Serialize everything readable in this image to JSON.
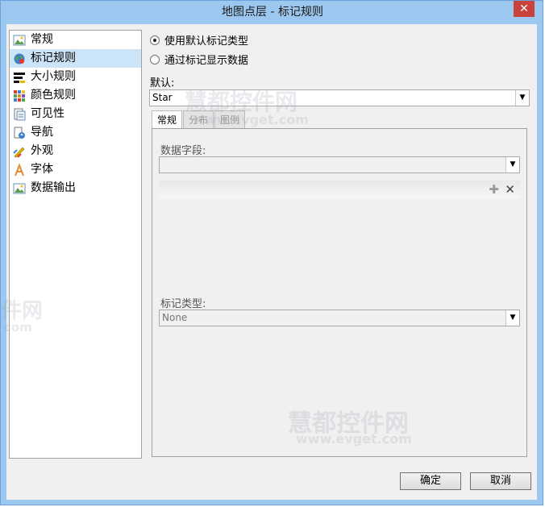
{
  "window": {
    "title": "地图点层 - 标记规则",
    "close_glyph": "✕"
  },
  "nav": {
    "items": [
      {
        "label": "常规",
        "icon": "landscape-icon",
        "active": false
      },
      {
        "label": "标记规则",
        "icon": "globe-marker-icon",
        "active": true
      },
      {
        "label": "大小规则",
        "icon": "size-bars-icon",
        "active": false
      },
      {
        "label": "颜色规则",
        "icon": "color-grid-icon",
        "active": false
      },
      {
        "label": "可见性",
        "icon": "visibility-icon",
        "active": false
      },
      {
        "label": "导航",
        "icon": "navigation-icon",
        "active": false
      },
      {
        "label": "外观",
        "icon": "appearance-icon",
        "active": false
      },
      {
        "label": "字体",
        "icon": "font-icon",
        "active": false
      },
      {
        "label": "数据输出",
        "icon": "data-output-icon",
        "active": false
      }
    ]
  },
  "options": {
    "default_type": "使用默认标记类型",
    "by_data": "通过标记显示数据",
    "selected": "default_type"
  },
  "default": {
    "label": "默认:",
    "value": "Star"
  },
  "tabs": [
    {
      "label": "常规",
      "active": true
    },
    {
      "label": "分布",
      "active": false
    },
    {
      "label": "图例",
      "active": false
    }
  ],
  "panel": {
    "data_field_label": "数据字段:",
    "data_field_value": "",
    "add_glyph": "✚",
    "remove_glyph": "✕",
    "marker_type_label": "标记类型:",
    "marker_type_value": "None"
  },
  "buttons": {
    "ok": "确定",
    "cancel": "取消"
  },
  "watermarks": {
    "line1": "慧都控件网",
    "line2": "www.evget.com",
    "side1": "件网",
    "side2": "com"
  },
  "colors": {
    "titlebar": "#9cc7ef",
    "selection": "#cce4f7",
    "close": "#c9423b"
  }
}
